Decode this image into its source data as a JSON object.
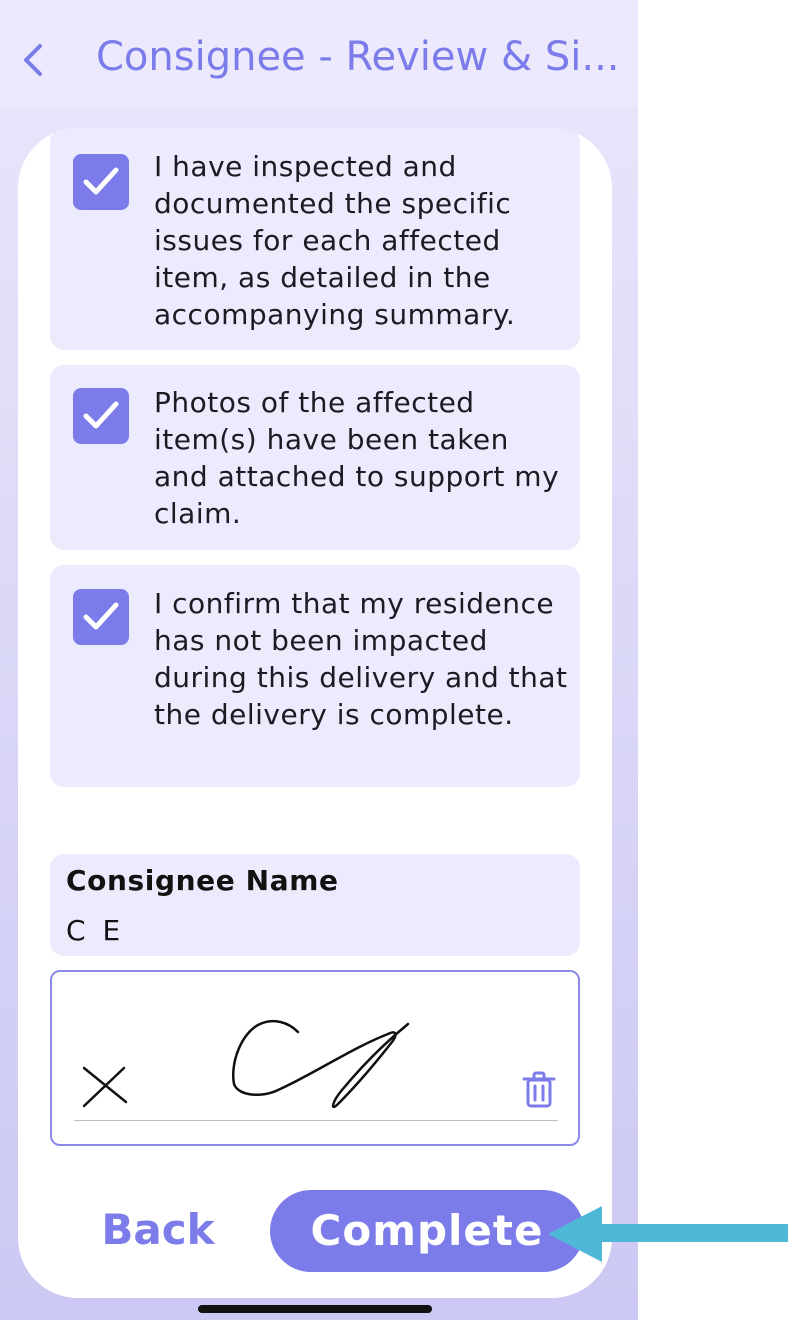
{
  "header": {
    "title": "Consignee - Review & Si...",
    "back_icon": "chevron-left-icon"
  },
  "checklist": [
    {
      "text": "I have inspected and documented the specific issues for each affected item, as detailed in the accompanying summary.",
      "checked": true
    },
    {
      "text": "Photos of the affected item(s) have been taken and attached to support my claim.",
      "checked": true
    },
    {
      "text": "I confirm that my residence has not been impacted during this delivery and that the delivery is complete.",
      "checked": true
    }
  ],
  "consignee": {
    "label": "Consignee Name",
    "value": "C E"
  },
  "signature": {
    "marker": "X",
    "clear_icon": "trash-icon"
  },
  "actions": {
    "back_label": "Back",
    "complete_label": "Complete"
  },
  "colors": {
    "accent": "#7b7bea",
    "item_bg": "#ecebfd",
    "annotation": "#4fb8d6"
  }
}
